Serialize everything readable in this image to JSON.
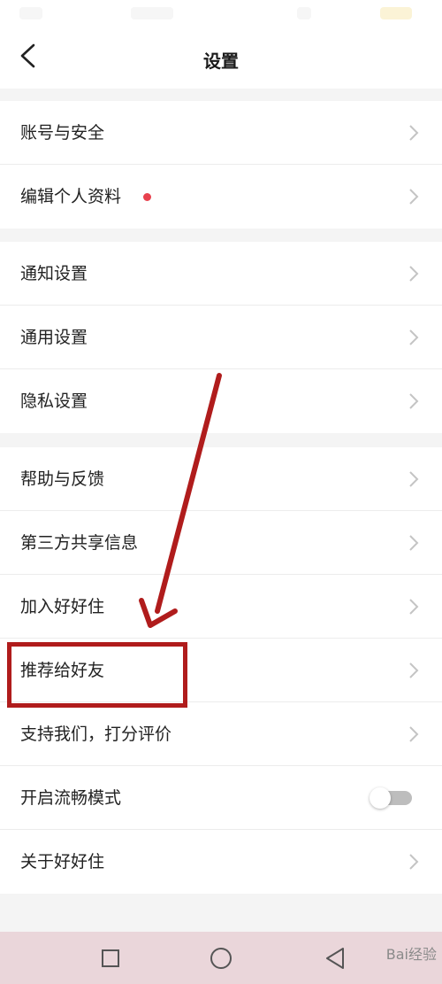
{
  "header": {
    "title": "设置",
    "back_icon": "chevron-left-icon"
  },
  "groups": [
    {
      "items": [
        {
          "label": "账号与安全"
        },
        {
          "label": "编辑个人资料",
          "badge": "red-dot"
        }
      ]
    },
    {
      "items": [
        {
          "label": "通知设置"
        },
        {
          "label": "通用设置"
        },
        {
          "label": "隐私设置"
        }
      ]
    },
    {
      "items": [
        {
          "label": "帮助与反馈"
        },
        {
          "label": "第三方共享信息"
        },
        {
          "label": "加入好好住"
        },
        {
          "label": "推荐给好友"
        },
        {
          "label": "支持我们，打分评价"
        },
        {
          "label": "开启流畅模式",
          "control": "toggle",
          "toggle_on": false
        },
        {
          "label": "关于好好住"
        }
      ]
    }
  ],
  "navbar": {
    "buttons": [
      "square-icon",
      "circle-icon",
      "triangle-back-icon"
    ]
  },
  "watermark": "Bai经验",
  "colors": {
    "accent_red": "#e8414e",
    "annotation_red": "#b01c1c",
    "navbar_bg": "#ead6da"
  }
}
